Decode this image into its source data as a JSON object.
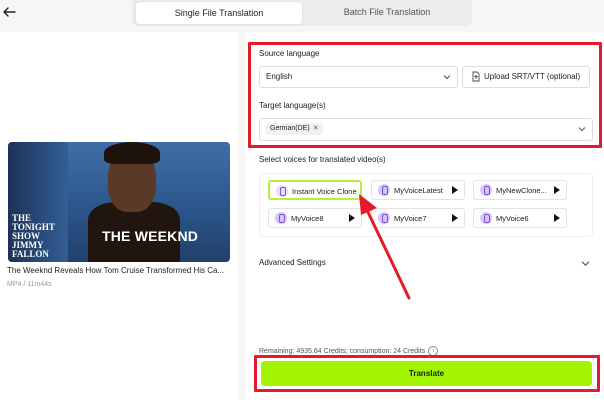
{
  "tabs": [
    {
      "label": "Single File Translation",
      "active": true
    },
    {
      "label": "Batch File Translation",
      "active": false
    }
  ],
  "icons": {
    "back": "arrow-left-icon",
    "upload": "upload-file-icon",
    "chevron": "chevron-down-icon",
    "voice": "headphones-icon",
    "play": "play-icon",
    "info": "info-icon"
  },
  "video": {
    "overlay_title": "THE WEEKND",
    "show_logo": "THE TONIGHT SHOW JIMMY FALLON",
    "title": "The Weeknd Reveals How Tom Cruise Transformed His Ca...",
    "meta": "MP4 / 11m44s"
  },
  "source": {
    "label": "Source language",
    "value": "English",
    "upload_label": "Upload SRT/VTT (optional)"
  },
  "target": {
    "label": "Target language(s)",
    "chips": [
      "German(DE)"
    ]
  },
  "voices": {
    "label": "Select voices for translated video(s)",
    "items": [
      {
        "name": "Instant Voice Clone",
        "selected": true,
        "playable": false
      },
      {
        "name": "MyVoiceLatest",
        "selected": false,
        "playable": true
      },
      {
        "name": "MyNewClone...",
        "selected": false,
        "playable": true
      },
      {
        "name": "MyVoice8",
        "selected": false,
        "playable": true
      },
      {
        "name": "MyVoice7",
        "selected": false,
        "playable": true
      },
      {
        "name": "MyVoice6",
        "selected": false,
        "playable": true
      }
    ]
  },
  "advanced": {
    "label": "Advanced Settings"
  },
  "credits": {
    "text": "Remaining: 4935.64 Credits; consumption: 24 Credits"
  },
  "translate": {
    "label": "Translate"
  },
  "colors": {
    "accent_green": "#a3f400",
    "highlight_red": "#e31b2a",
    "selected_border": "#b5f03c",
    "voice_purple": "#7b4fd1"
  }
}
